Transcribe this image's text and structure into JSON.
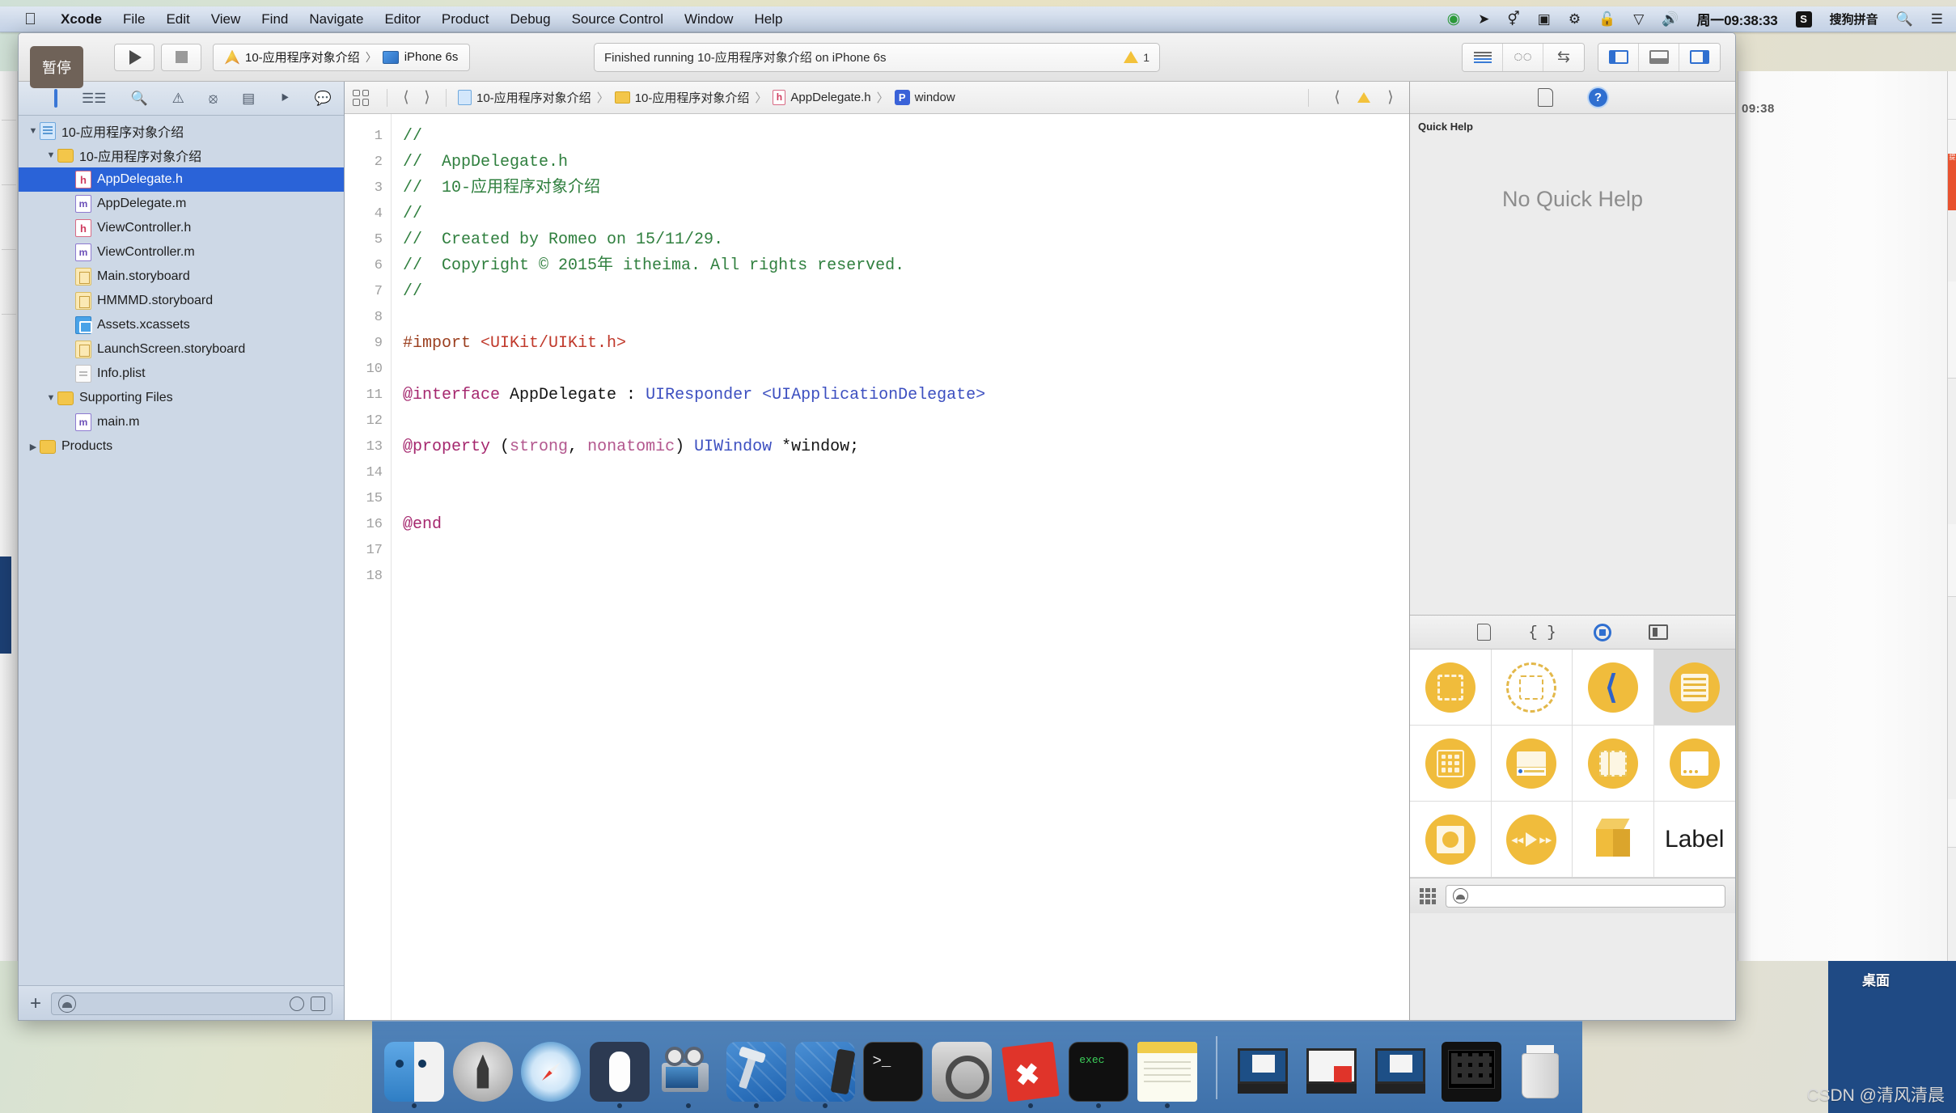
{
  "menubar": {
    "apple": "",
    "items": [
      "Xcode",
      "File",
      "Edit",
      "View",
      "Find",
      "Navigate",
      "Editor",
      "Product",
      "Debug",
      "Source Control",
      "Window",
      "Help"
    ],
    "status_icons": [
      "dropbox-icon",
      "location-icon",
      "bluetooth-icon",
      "screen-recording-icon",
      "network-icon",
      "lock-icon",
      "wifi-icon",
      "volume-icon"
    ],
    "clock": "周一09:38:33",
    "ime_badge": "S",
    "ime_label": "搜狗拼音",
    "spotlight_icon": "search-icon",
    "notification_icon": "list-icon"
  },
  "tooltip": {
    "text": "暂停"
  },
  "toolbar": {
    "run_icon": "play-icon",
    "stop_icon": "stop-icon",
    "scheme_name": "10-应用程序对象介绍",
    "scheme_separator": "〉",
    "destination": "iPhone 6s",
    "status_message": "Finished running 10-应用程序对象介绍 on iPhone 6s",
    "warning_count": "1",
    "editor_modes": [
      "standard-editor-icon",
      "assistant-editor-icon",
      "version-editor-icon"
    ],
    "panel_toggles": [
      "navigator-toggle-icon",
      "debug-area-toggle-icon",
      "utilities-toggle-icon"
    ]
  },
  "navigator": {
    "tabs": [
      "project-navigator-icon",
      "symbol-navigator-icon",
      "find-navigator-icon",
      "issue-navigator-icon",
      "test-navigator-icon",
      "debug-navigator-icon",
      "breakpoint-navigator-icon",
      "report-navigator-icon"
    ],
    "tree": [
      {
        "label": "10-应用程序对象介绍",
        "indent": 0,
        "icon": "proj",
        "disc": "▼",
        "selected": false
      },
      {
        "label": "10-应用程序对象介绍",
        "indent": 1,
        "icon": "folder",
        "disc": "▼",
        "selected": false
      },
      {
        "label": "AppDelegate.h",
        "indent": 2,
        "icon": "h",
        "disc": "",
        "selected": true
      },
      {
        "label": "AppDelegate.m",
        "indent": 2,
        "icon": "m",
        "disc": "",
        "selected": false
      },
      {
        "label": "ViewController.h",
        "indent": 2,
        "icon": "h",
        "disc": "",
        "selected": false
      },
      {
        "label": "ViewController.m",
        "indent": 2,
        "icon": "m",
        "disc": "",
        "selected": false
      },
      {
        "label": "Main.storyboard",
        "indent": 2,
        "icon": "sb",
        "disc": "",
        "selected": false
      },
      {
        "label": "HMMMD.storyboard",
        "indent": 2,
        "icon": "sb",
        "disc": "",
        "selected": false
      },
      {
        "label": "Assets.xcassets",
        "indent": 2,
        "icon": "xcassets",
        "disc": "",
        "selected": false
      },
      {
        "label": "LaunchScreen.storyboard",
        "indent": 2,
        "icon": "sb",
        "disc": "",
        "selected": false
      },
      {
        "label": "Info.plist",
        "indent": 2,
        "icon": "plist",
        "disc": "",
        "selected": false
      },
      {
        "label": "Supporting Files",
        "indent": 1,
        "icon": "folder",
        "disc": "▼",
        "selected": false
      },
      {
        "label": "main.m",
        "indent": 2,
        "icon": "m",
        "disc": "",
        "selected": false
      },
      {
        "label": "Products",
        "indent": 0,
        "icon": "folder",
        "disc": "▶",
        "selected": false
      }
    ],
    "bottom": {
      "add_icon": "plus-icon",
      "filter_icon": "filter-icon",
      "filter_placeholder": "",
      "recent_icon": "clock-icon",
      "source_control_icon": "source-control-icon"
    }
  },
  "jumpbar": {
    "related_icon": "related-items-icon",
    "back_icon": "back-chevron-icon",
    "forward_icon": "forward-chevron-icon",
    "crumbs": [
      {
        "label": "10-应用程序对象介绍",
        "icon": "proj"
      },
      {
        "label": "10-应用程序对象介绍",
        "icon": "folder"
      },
      {
        "label": "AppDelegate.h",
        "icon": "h"
      },
      {
        "label": "window",
        "icon": "p"
      }
    ],
    "separator": "〉",
    "prev_issue_icon": "prev-issue-icon",
    "warning_icon": "warning-icon",
    "next_issue_icon": "next-issue-icon"
  },
  "code": {
    "filename": "AppDelegate.h",
    "line_numbers": [
      "1",
      "2",
      "3",
      "4",
      "5",
      "6",
      "7",
      "8",
      "9",
      "10",
      "11",
      "12",
      "13",
      "14",
      "15",
      "16",
      "17",
      "18"
    ],
    "lines": [
      {
        "n": 1,
        "text": "//"
      },
      {
        "n": 2,
        "text": "//  AppDelegate.h"
      },
      {
        "n": 3,
        "text": "//  10-应用程序对象介绍"
      },
      {
        "n": 4,
        "text": "//"
      },
      {
        "n": 5,
        "text": "//  Created by Romeo on 15/11/29."
      },
      {
        "n": 6,
        "text": "//  Copyright © 2015年 itheima. All rights reserved."
      },
      {
        "n": 7,
        "text": "//"
      },
      {
        "n": 8,
        "text": ""
      },
      {
        "n": 9,
        "text": "#import <UIKit/UIKit.h>"
      },
      {
        "n": 10,
        "text": ""
      },
      {
        "n": 11,
        "text": "@interface AppDelegate : UIResponder <UIApplicationDelegate>"
      },
      {
        "n": 12,
        "text": ""
      },
      {
        "n": 13,
        "text": "@property (strong, nonatomic) UIWindow *window;"
      },
      {
        "n": 14,
        "text": ""
      },
      {
        "n": 15,
        "text": ""
      },
      {
        "n": 16,
        "text": "@end"
      },
      {
        "n": 17,
        "text": ""
      },
      {
        "n": 18,
        "text": ""
      }
    ]
  },
  "utilities": {
    "tabs": [
      "file-inspector-icon",
      "quick-help-inspector-icon"
    ],
    "quick_help": {
      "title": "Quick Help",
      "empty_message": "No Quick Help"
    },
    "library_tabs": [
      "file-template-library-icon",
      "code-snippet-library-icon",
      "object-library-icon",
      "media-library-icon"
    ],
    "library_items": [
      {
        "name": "view-object",
        "label": "",
        "selected": false
      },
      {
        "name": "view-container-object",
        "label": "",
        "selected": false
      },
      {
        "name": "navigation-bar-back-object",
        "label": "",
        "selected": false
      },
      {
        "name": "table-view-object",
        "label": "",
        "selected": true
      },
      {
        "name": "collection-view-object",
        "label": "",
        "selected": false
      },
      {
        "name": "navigation-controller-object",
        "label": "",
        "selected": false
      },
      {
        "name": "split-view-object",
        "label": "",
        "selected": false
      },
      {
        "name": "page-view-object",
        "label": "",
        "selected": false
      },
      {
        "name": "glkit-view-object",
        "label": "",
        "selected": false
      },
      {
        "name": "avplayer-view-object",
        "label": "",
        "selected": false
      },
      {
        "name": "scene-kit-object",
        "label": "",
        "selected": false
      },
      {
        "name": "label-object",
        "label": "Label",
        "selected": false
      }
    ],
    "library_filter": {
      "grid_icon": "grid-view-icon",
      "search_icon": "filter-icon",
      "placeholder": ""
    }
  },
  "dock": {
    "items": [
      {
        "name": "finder",
        "running": true
      },
      {
        "name": "launchpad",
        "running": false
      },
      {
        "name": "safari",
        "running": false
      },
      {
        "name": "mouse-utility",
        "running": true
      },
      {
        "name": "quicktime-player",
        "running": true
      },
      {
        "name": "xcode",
        "running": true
      },
      {
        "name": "xcode-simulator",
        "running": true
      },
      {
        "name": "terminal",
        "running": false
      },
      {
        "name": "system-preferences",
        "running": false
      },
      {
        "name": "xmind",
        "running": true
      },
      {
        "name": "exec-terminal",
        "running": true
      },
      {
        "name": "notes",
        "running": true
      }
    ],
    "minimized": [
      {
        "name": "minimized-window-1"
      },
      {
        "name": "minimized-window-2"
      },
      {
        "name": "minimized-window-3"
      },
      {
        "name": "minimized-iphone-simulator"
      }
    ],
    "trash": {
      "name": "trash"
    }
  },
  "desktop": {
    "label": "桌面",
    "background_window_time": "09:38",
    "watermark": "CSDN @清风清晨"
  }
}
